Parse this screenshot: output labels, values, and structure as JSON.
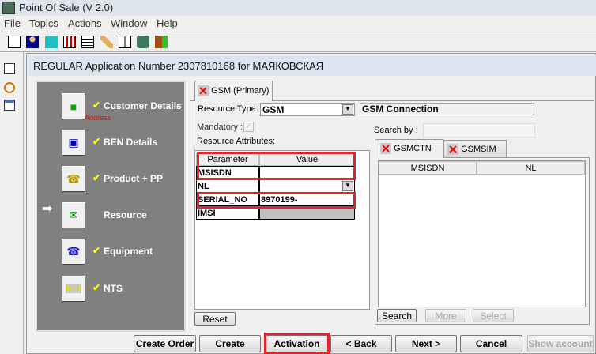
{
  "app": {
    "title": "Point Of Sale  (V 2.0)"
  },
  "menu": [
    "File",
    "Topics",
    "Actions",
    "Window",
    "Help"
  ],
  "window": {
    "title": "REGULAR Application Number 2307810168 for МАЯКОВСКАЯ"
  },
  "nav": {
    "items": [
      {
        "label": "Customer Details",
        "sub": "Address",
        "done": true
      },
      {
        "label": "BEN Details",
        "done": true
      },
      {
        "label": "Product + PP",
        "done": true
      },
      {
        "label": "Resource",
        "done": false,
        "current": true
      },
      {
        "label": "Equipment",
        "done": true
      },
      {
        "label": "NTS",
        "done": true
      }
    ]
  },
  "tab": {
    "label": "GSM (Primary)"
  },
  "form": {
    "resource_type_label": "Resource Type:",
    "resource_type": "GSM",
    "resource_desc": "GSM Connection",
    "mandatory_label": "Mandatory :",
    "attributes_label": "Resource Attributes:",
    "reset": "Reset"
  },
  "attributes": {
    "headers": [
      "Parameter",
      "Value"
    ],
    "rows": [
      {
        "param": "MSISDN",
        "value": ""
      },
      {
        "param": "NL",
        "value": ""
      },
      {
        "param": "SERIAL_NO",
        "value": "8970199-"
      },
      {
        "param": "IMSI",
        "value": ""
      }
    ]
  },
  "search": {
    "label": "Search by :",
    "value": "",
    "tabs": [
      "GSMCTN",
      "GSMSIM"
    ],
    "headers": [
      "MSISDN",
      "NL"
    ],
    "buttons": [
      "Search",
      "More",
      "Select"
    ]
  },
  "footer": {
    "buttons": [
      "Create Order",
      "Create",
      "Activation",
      "< Back",
      "Next >",
      "Cancel",
      "Show account"
    ]
  }
}
